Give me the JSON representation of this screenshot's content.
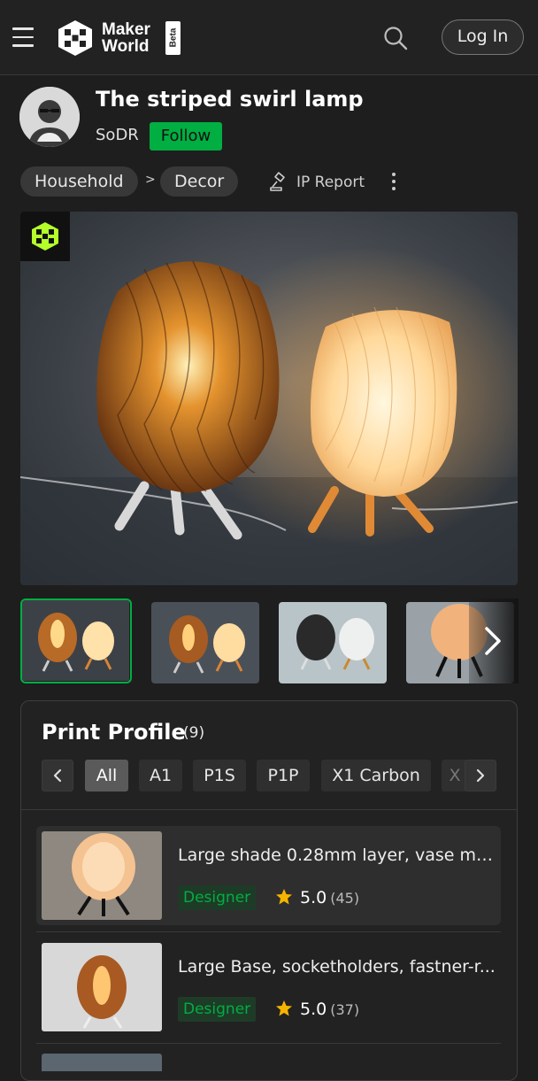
{
  "header": {
    "logo_line1": "Maker",
    "logo_line2": "World",
    "beta_label": "Beta",
    "login_label": "Log In"
  },
  "model": {
    "title": "The striped swirl lamp",
    "author": "SoDR",
    "follow_label": "Follow",
    "breadcrumb": [
      "Household",
      "Decor"
    ],
    "breadcrumb_separator": ">",
    "ip_report_label": "IP Report"
  },
  "gallery": {
    "thumbnail_count_visible": 4,
    "selected_index": 0
  },
  "print_profile": {
    "title": "Print Profile",
    "count": "(9)",
    "filters": [
      "All",
      "A1",
      "P1S",
      "P1P",
      "X1 Carbon",
      "X"
    ],
    "active_filter": "All",
    "profiles": [
      {
        "name": "Large shade 0.28mm layer, vase mo...",
        "tag": "Designer",
        "rating": "5.0",
        "reviews": "(45)"
      },
      {
        "name": "Large Base, socketholders, fastner-r...",
        "tag": "Designer",
        "rating": "5.0",
        "reviews": "(37)"
      }
    ]
  },
  "colors": {
    "accent": "#00ae42",
    "background": "#1e1e1e",
    "star": "#f5b400"
  },
  "icons": [
    "hamburger-icon",
    "makerworld-logo-icon",
    "search-icon",
    "avatar-icon",
    "ip-report-icon",
    "more-vertical-icon",
    "chevron-left-icon",
    "chevron-right-icon",
    "star-icon"
  ]
}
